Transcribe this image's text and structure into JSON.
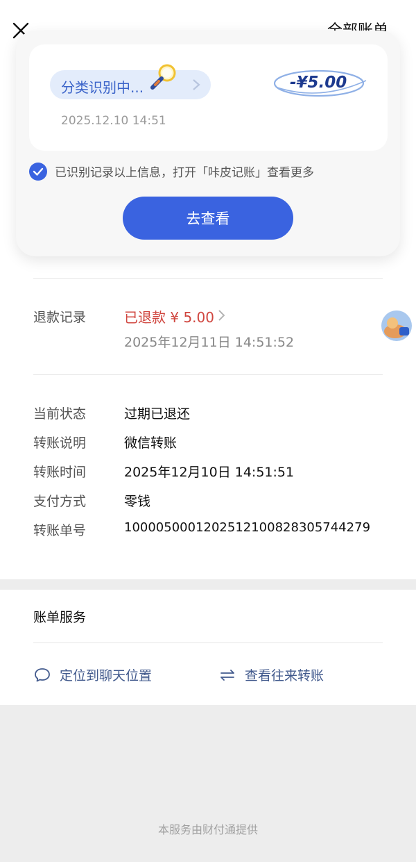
{
  "header": {
    "top_right_link": "全部账单"
  },
  "popup": {
    "category_label": "分类识别中...",
    "amount": "-¥5.00",
    "date": "2025.12.10 14:51",
    "info_text": "已识别记录以上信息，打开「咔皮记账」查看更多",
    "view_button": "去查看"
  },
  "refund": {
    "label": "退款记录",
    "status": "已退款 ¥ 5.00",
    "date": "2025年12月11日 14:51:52"
  },
  "details": [
    {
      "label": "当前状态",
      "value": "过期已退还"
    },
    {
      "label": "转账说明",
      "value": "微信转账"
    },
    {
      "label": "转账时间",
      "value": "2025年12月10日 14:51:51"
    },
    {
      "label": "支付方式",
      "value": "零钱"
    },
    {
      "label": "转账单号",
      "value": "1000050001202512100828305744279"
    }
  ],
  "services": {
    "title": "账单服务",
    "locate_chat": "定位到聊天位置",
    "view_transfers": "查看往来转账"
  },
  "footer": "本服务由财付通提供",
  "colors": {
    "accent": "#3a63e0",
    "refund_red": "#d0463f",
    "link_blue": "#425a8d"
  }
}
